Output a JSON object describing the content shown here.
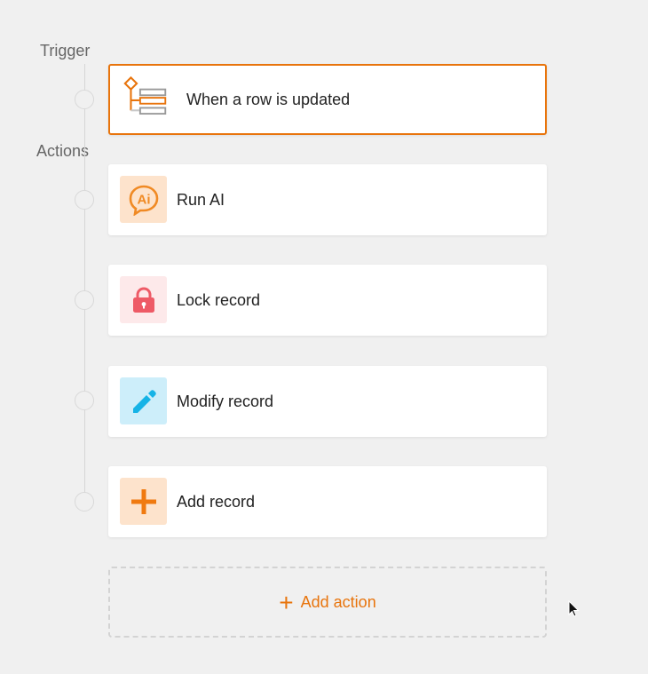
{
  "sections": {
    "trigger_label": "Trigger",
    "actions_label": "Actions"
  },
  "trigger": {
    "label": "When a row is updated",
    "icon": "row-updated-icon"
  },
  "actions": [
    {
      "label": "Run AI",
      "icon": "ai-icon",
      "icon_bg": "#fde3cc",
      "icon_color": "#f08a24"
    },
    {
      "label": "Lock record",
      "icon": "lock-icon",
      "icon_bg": "#fde9ea",
      "icon_color": "#ee5a66"
    },
    {
      "label": "Modify record",
      "icon": "pencil-icon",
      "icon_bg": "#cdeefa",
      "icon_color": "#16b3e6"
    },
    {
      "label": "Add record",
      "icon": "plus-icon",
      "icon_bg": "#fde3cc",
      "icon_color": "#f07a10"
    }
  ],
  "add_action": {
    "label": "Add action",
    "plus": "+"
  },
  "colors": {
    "accent": "#e8740c",
    "background": "#f0f0f0"
  }
}
